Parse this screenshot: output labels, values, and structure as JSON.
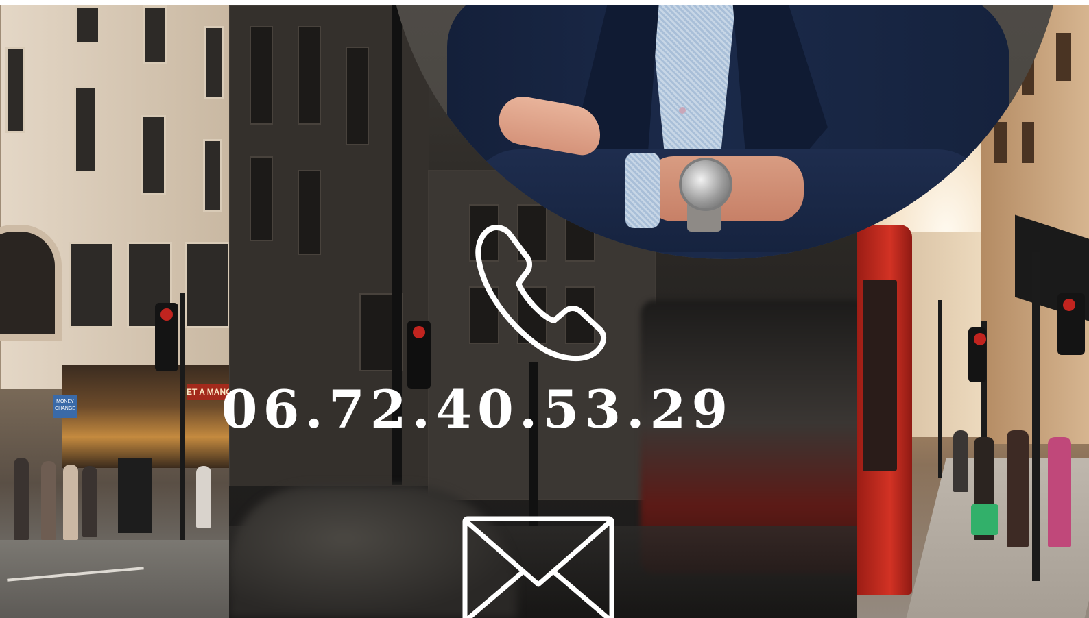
{
  "contact": {
    "phone_number": "06.72.40.53.29",
    "phone_icon": "phone-handset-icon",
    "mail_icon": "envelope-icon"
  },
  "shop_signs": {
    "money_change": "MONEY CHANGE",
    "shop_name": "ET A MANGER"
  },
  "colors": {
    "text": "#ffffff",
    "bus_red": "#d23224",
    "jacket_navy": "#1b2a4a"
  }
}
